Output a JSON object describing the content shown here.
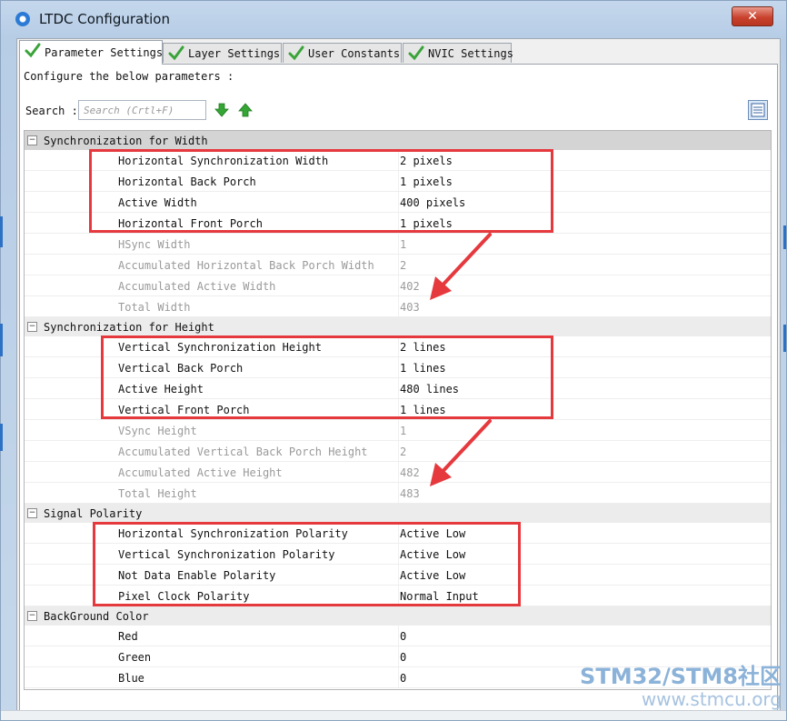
{
  "window": {
    "title": "LTDC Configuration",
    "close_glyph": "✕"
  },
  "tabs": [
    {
      "label": "Parameter Settings",
      "active": true
    },
    {
      "label": "Layer Settings",
      "active": false
    },
    {
      "label": "User Constants",
      "active": false
    },
    {
      "label": "NVIC Settings",
      "active": false
    }
  ],
  "panel": {
    "configure_text": "Configure the below parameters :",
    "search_label": "Search :",
    "search_placeholder": "Search (Crtl+F)"
  },
  "groups": [
    {
      "title": "Synchronization for Width",
      "rows": [
        {
          "name": "Horizontal Synchronization Width",
          "value": "2 pixels",
          "readonly": false
        },
        {
          "name": "Horizontal Back Porch",
          "value": "1 pixels",
          "readonly": false
        },
        {
          "name": "Active Width",
          "value": "400 pixels",
          "readonly": false
        },
        {
          "name": "Horizontal Front Porch",
          "value": "1 pixels",
          "readonly": false
        },
        {
          "name": "HSync Width",
          "value": "1",
          "readonly": true
        },
        {
          "name": "Accumulated Horizontal Back Porch Width",
          "value": "2",
          "readonly": true
        },
        {
          "name": "Accumulated Active Width",
          "value": "402",
          "readonly": true
        },
        {
          "name": "Total Width",
          "value": "403",
          "readonly": true
        }
      ]
    },
    {
      "title": "Synchronization for Height",
      "rows": [
        {
          "name": "Vertical Synchronization Height",
          "value": "2 lines",
          "readonly": false
        },
        {
          "name": "Vertical Back Porch",
          "value": "1 lines",
          "readonly": false
        },
        {
          "name": "Active Height",
          "value": "480 lines",
          "readonly": false
        },
        {
          "name": "Vertical Front Porch",
          "value": "1 lines",
          "readonly": false
        },
        {
          "name": "VSync Height",
          "value": "1",
          "readonly": true
        },
        {
          "name": "Accumulated Vertical Back Porch Height",
          "value": "2",
          "readonly": true
        },
        {
          "name": "Accumulated Active Height",
          "value": "482",
          "readonly": true
        },
        {
          "name": "Total Height",
          "value": "483",
          "readonly": true
        }
      ]
    },
    {
      "title": "Signal Polarity",
      "rows": [
        {
          "name": "Horizontal Synchronization Polarity",
          "value": "Active Low",
          "readonly": false
        },
        {
          "name": "Vertical Synchronization Polarity",
          "value": "Active Low",
          "readonly": false
        },
        {
          "name": "Not Data Enable Polarity",
          "value": "Active Low",
          "readonly": false
        },
        {
          "name": "Pixel Clock Polarity",
          "value": "Normal Input",
          "readonly": false
        }
      ]
    },
    {
      "title": "BackGround Color",
      "rows": [
        {
          "name": "Red",
          "value": "0",
          "readonly": false
        },
        {
          "name": "Green",
          "value": "0",
          "readonly": false
        },
        {
          "name": "Blue",
          "value": "0",
          "readonly": false
        }
      ]
    }
  ],
  "watermark": {
    "line1": "STM32/STM8社区",
    "line2": "www.stmcu.org"
  },
  "colors": {
    "highlight": "#e5393e",
    "readonly_text": "#9a9a9a",
    "tab_check": "#3aa33a"
  }
}
